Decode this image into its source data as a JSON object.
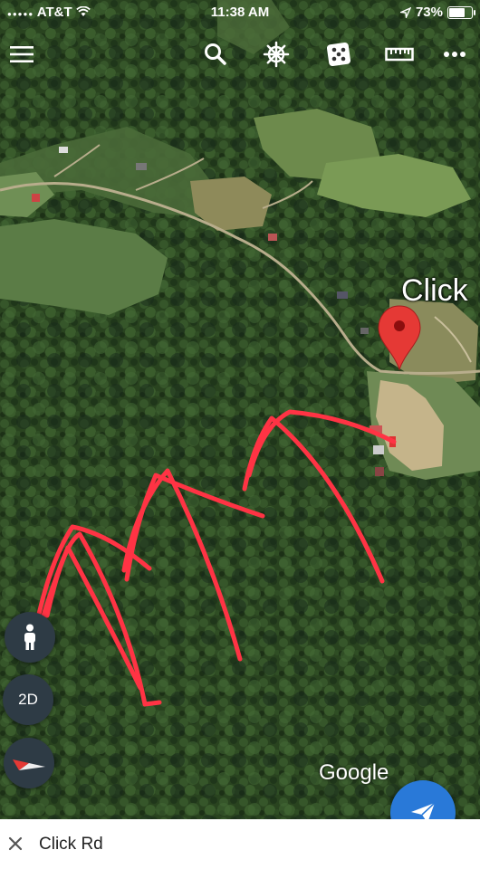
{
  "status_bar": {
    "carrier": "AT&T",
    "time": "11:38 AM",
    "battery": "73%",
    "battery_level": 0.73
  },
  "toolbar": {
    "icons": [
      "menu-icon",
      "search-icon",
      "voyager-wheel-icon",
      "dice-icon",
      "ruler-icon",
      "more-icon"
    ]
  },
  "map": {
    "place_label": "Click",
    "marker_color": "#e53935",
    "annotation_color": "#ff3344",
    "attribution": "Google"
  },
  "controls": {
    "pegman": "pegman-icon",
    "view_mode": "2D",
    "compass": "compass-icon"
  },
  "fab": {
    "icon": "share-send-icon",
    "color": "#2979d8"
  },
  "bottom_bar": {
    "title": "Click Rd"
  }
}
